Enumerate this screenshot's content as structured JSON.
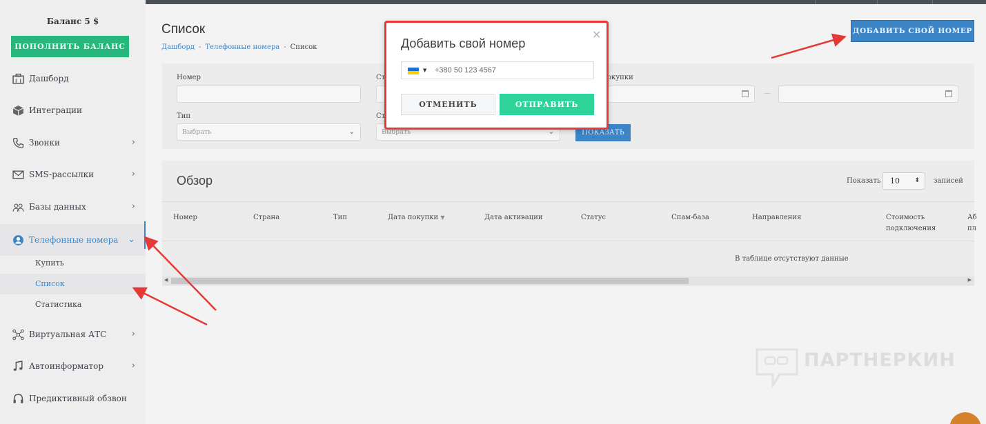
{
  "sidebar": {
    "balance": "Баланс 5 $",
    "topup_label": "ПОПОЛНИТЬ БАЛАНС",
    "items": [
      {
        "label": "Дашборд",
        "icon": "briefcase-icon"
      },
      {
        "label": "Интеграции",
        "icon": "cube-icon"
      },
      {
        "label": "Звонки",
        "icon": "phone-icon"
      },
      {
        "label": "SMS-рассылки",
        "icon": "envelope-icon"
      },
      {
        "label": "Базы данных",
        "icon": "users-icon"
      },
      {
        "label": "Телефонные номера",
        "icon": "user-circle-icon"
      },
      {
        "label": "Виртуальная АТС",
        "icon": "network-icon"
      },
      {
        "label": "Автоинформатор",
        "icon": "music-note-icon"
      },
      {
        "label": "Предиктивный обзвон",
        "icon": "headset-icon"
      }
    ],
    "sub_items": [
      "Купить",
      "Список",
      "Статистика"
    ]
  },
  "page": {
    "title": "Список",
    "breadcrumb": [
      "Дашборд",
      "Телефонные номера",
      "Список"
    ],
    "add_own_number_label": "ДОБАВИТЬ СВОЙ НОМЕР"
  },
  "filters": {
    "number_label": "Номер",
    "country_label": "Ст",
    "purchase_label": "окупки",
    "type_label": "Тип",
    "type_placeholder": "Выбрать",
    "status_label": "Ст",
    "status_placeholder": "Выбрать",
    "range_separator": "—",
    "show_label": "ПОКАЗАТЬ"
  },
  "overview": {
    "title": "Обзор",
    "show_label": "Показать",
    "page_size": "10",
    "records_label": "записей",
    "columns": [
      "Номер",
      "Страна",
      "Тип",
      "Дата покупки",
      "Дата активации",
      "Статус",
      "Спам-база",
      "Направления",
      "Стоимость подключения",
      "Аб пл"
    ],
    "sort_indicator": "▼",
    "empty_text": "В таблице отсутствуют данные"
  },
  "modal": {
    "title": "Добавить свой номер",
    "phone_placeholder": "+380 50 123 4567",
    "cancel_label": "ОТМЕНИТЬ",
    "submit_label": "ОТПРАВИТЬ",
    "close_glyph": "×"
  },
  "watermark": {
    "text": "ПАРТНЕРКИН"
  },
  "colors": {
    "accent": "#3c86c8",
    "success": "#27b77c",
    "send": "#2ed39a",
    "annotation": "#e53935"
  }
}
